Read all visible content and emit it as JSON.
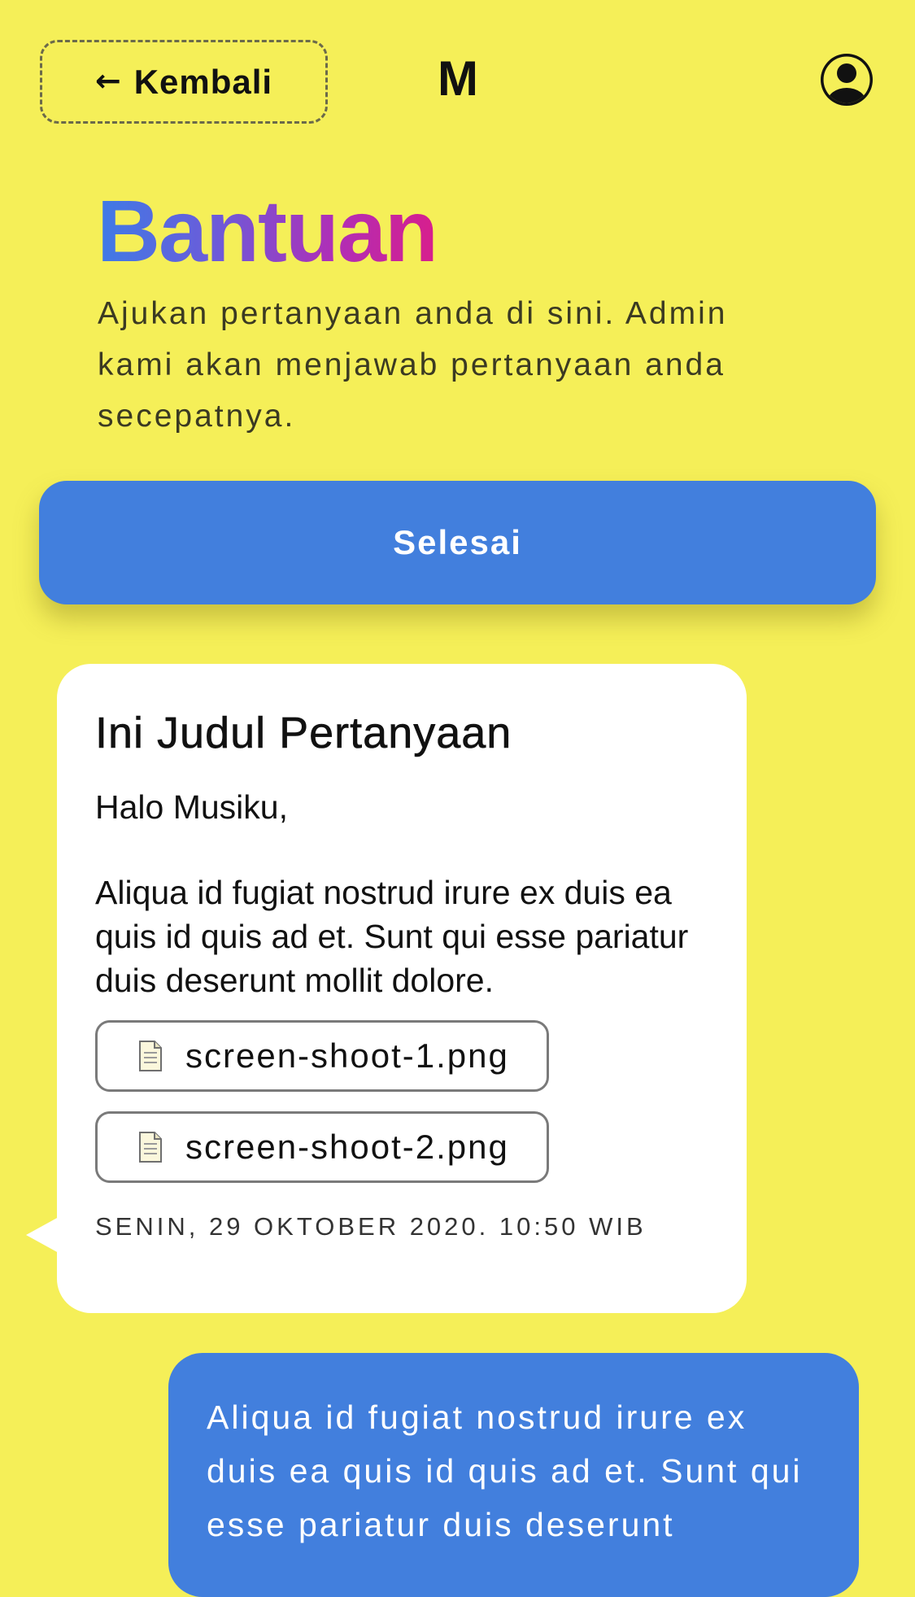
{
  "header": {
    "back_arrow": "←",
    "back_label": "Kembali",
    "brand": "M",
    "profile_icon": "user-circle-icon"
  },
  "page": {
    "title": "Bantuan",
    "description": "Ajukan pertanyaan anda di sini. Admin kami akan menjawab pertanyaan anda secepatnya."
  },
  "actions": {
    "finish_label": "Selesai"
  },
  "question": {
    "title": "Ini Judul Pertanyaan",
    "greeting": "Halo Musiku,",
    "body": "Aliqua id fugiat nostrud irure ex duis ea quis id quis ad et. Sunt qui esse pariatur duis deserunt mollit dolore.",
    "attachments": [
      {
        "name": "screen-shoot-1.png",
        "icon": "file-icon"
      },
      {
        "name": "screen-shoot-2.png",
        "icon": "file-icon"
      }
    ],
    "timestamp": "SENIN, 29 OKTOBER 2020. 10:50 WIB"
  },
  "reply": {
    "text": "Aliqua id fugiat nostrud irure ex duis ea quis id quis ad et. Sunt qui esse pariatur duis deserunt"
  },
  "colors": {
    "background": "#F5EF58",
    "accent_blue": "#427FDD",
    "title_gradient_start": "#3E7BE6",
    "title_gradient_end": "#D81E8C",
    "bubble_white": "#FFFFFF"
  }
}
